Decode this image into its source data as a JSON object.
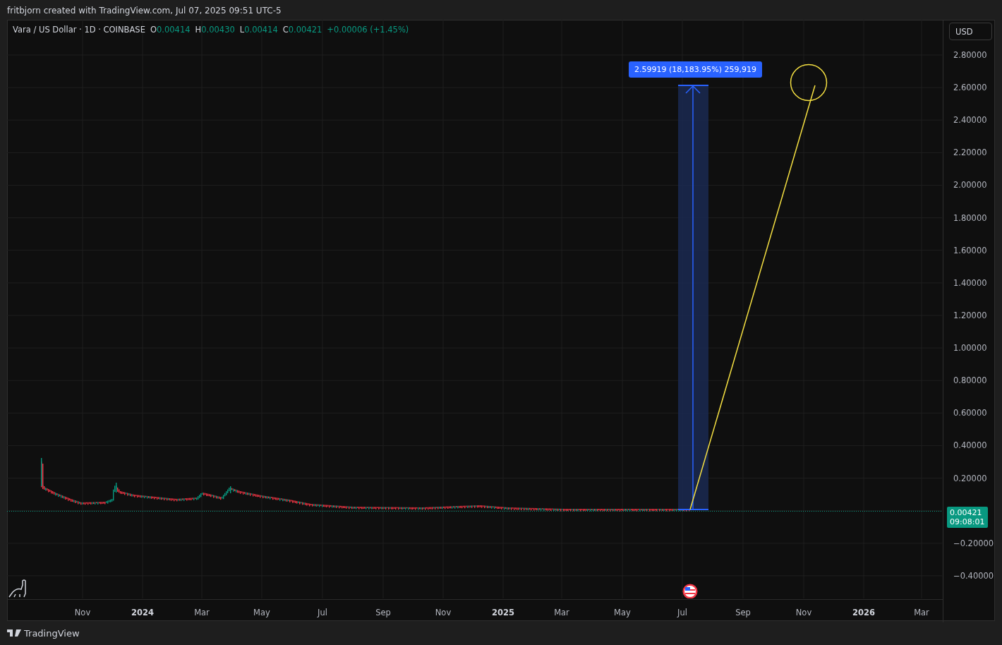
{
  "header": {
    "caption": "fritbjorn created with TradingView.com, Jul 07, 2025 09:51 UTC-5"
  },
  "legend": {
    "symbol": "Vara / US Dollar · 1D · COINBASE",
    "fields": [
      {
        "label": "O",
        "value": "0.00414"
      },
      {
        "label": "H",
        "value": "0.00430"
      },
      {
        "label": "L",
        "value": "0.00414"
      },
      {
        "label": "C",
        "value": "0.00421"
      }
    ],
    "change": "+0.00006 (+1.45%)"
  },
  "currency_button": "USD",
  "measure_label": "2.59919 (18,183.95%) 259,919",
  "price_axis": [
    "2.80000",
    "2.60000",
    "2.40000",
    "2.20000",
    "2.00000",
    "1.80000",
    "1.60000",
    "1.40000",
    "1.20000",
    "1.00000",
    "0.80000",
    "0.60000",
    "0.40000",
    "0.20000",
    "−0.20000",
    "−0.40000"
  ],
  "current_price": {
    "price": "0.00421",
    "countdown": "09:08:01"
  },
  "time_axis": [
    {
      "label": "Nov",
      "bold": false
    },
    {
      "label": "2024",
      "bold": true
    },
    {
      "label": "Mar",
      "bold": false
    },
    {
      "label": "May",
      "bold": false
    },
    {
      "label": "Jul",
      "bold": false
    },
    {
      "label": "Sep",
      "bold": false
    },
    {
      "label": "Nov",
      "bold": false
    },
    {
      "label": "2025",
      "bold": true
    },
    {
      "label": "Mar",
      "bold": false
    },
    {
      "label": "May",
      "bold": false
    },
    {
      "label": "Jul",
      "bold": false
    },
    {
      "label": "Sep",
      "bold": false
    },
    {
      "label": "Nov",
      "bold": false
    },
    {
      "label": "2026",
      "bold": true
    },
    {
      "label": "Mar",
      "bold": false
    }
  ],
  "footer": {
    "brand": "TradingView"
  }
}
